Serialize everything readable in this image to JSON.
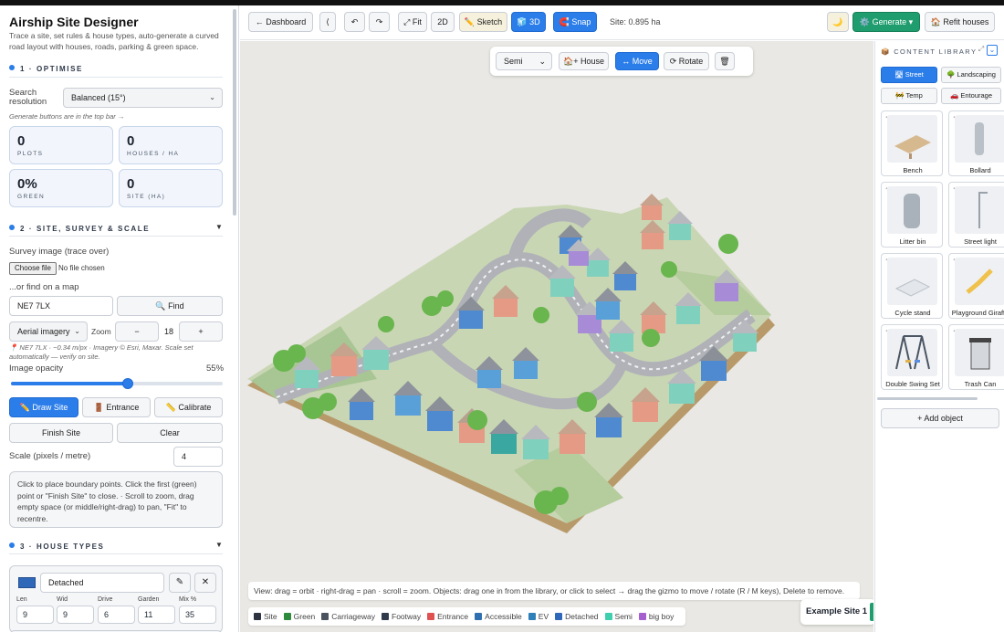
{
  "app": {
    "title": "Airship Site Designer",
    "subtitle": "Trace a site, set rules & house types, auto-generate a curved road layout with houses, roads, parking & green space."
  },
  "optimise": {
    "heading": "1 · OPTIMISE",
    "search_label": "Search resolution",
    "search_value": "Balanced (15°)",
    "note": "Generate buttons are in the top bar →",
    "stats": [
      {
        "value": "0",
        "label": "PLOTS"
      },
      {
        "value": "0",
        "label": "HOUSES / HA"
      },
      {
        "value": "0%",
        "label": "GREEN"
      },
      {
        "value": "0",
        "label": "SITE (HA)"
      }
    ]
  },
  "survey": {
    "heading": "2 · SITE, SURVEY & SCALE",
    "caret": "▼",
    "survey_label": "Survey image (trace over)",
    "choose_file": "Choose file",
    "no_file": "No file chosen",
    "find_label": "...or find on a map",
    "postcode": "NE7 7LX",
    "find_button": "🔍 Find",
    "imagery": "Aerial imagery",
    "zoom_label": "Zoom",
    "zoom_minus": "−",
    "zoom_value": "18",
    "zoom_plus": "+",
    "imagery_note": "📍 NE7 7LX · ~0.34 m/px · Imagery © Esri, Maxar. Scale set automatically — verify on site.",
    "opacity_label": "Image opacity",
    "opacity_value": "55%",
    "opacity_fraction": 0.55,
    "draw_site": "✏️ Draw Site",
    "entrance": "🚪 Entrance",
    "calibrate": "📏 Calibrate",
    "finish_site": "Finish Site",
    "clear": "Clear",
    "scale_label": "Scale (pixels / metre)",
    "scale_value": "4",
    "hint": "Click to place boundary points. Click the first (green) point or \"Finish Site\" to close. · Scroll to zoom, drag empty space (or middle/right-drag) to pan, \"Fit\" to recentre."
  },
  "house_types": {
    "heading": "3 · HOUSE TYPES",
    "caret": "▼",
    "card": {
      "name": "Detached",
      "swatch_color": "#2f68b8",
      "edit_icon": "✎",
      "remove_icon": "✕",
      "fields": [
        {
          "label": "Len",
          "value": "9"
        },
        {
          "label": "Wid",
          "value": "9"
        },
        {
          "label": "Drive",
          "value": "6"
        },
        {
          "label": "Garden",
          "value": "11"
        },
        {
          "label": "Mix %",
          "value": "35"
        }
      ]
    }
  },
  "topbar": {
    "dashboard": "← Dashboard",
    "collapse": "⟨",
    "undo": "↶",
    "redo": "↷",
    "fit": "⤢ Fit",
    "twod": "2D",
    "sketch": "✏️ Sketch",
    "threed": "🧊 3D",
    "snap": "🧲 Snap",
    "site_area": "Site: 0.895 ha",
    "theme": "🌙",
    "generate": "⚙️ Generate ▾",
    "refit": "🏠 Refit houses"
  },
  "viewport_toolbar": {
    "type_select": "Semi",
    "house": "🏠+ House",
    "move": "↔ Move",
    "rotate": "⟳ Rotate",
    "delete": "🗑"
  },
  "help_text": "View: drag = orbit · right-drag = pan · scroll = zoom. Objects: drag one in from the library, or click to select → drag the gizmo to move / rotate (R / M keys), Delete to remove.",
  "legend": [
    {
      "label": "Site",
      "color": "#2d3340"
    },
    {
      "label": "Green",
      "color": "#2e8b3e"
    },
    {
      "label": "Carriageway",
      "color": "#4a5260"
    },
    {
      "label": "Footway",
      "color": "#2f3b4c"
    },
    {
      "label": "Entrance",
      "color": "#e05252"
    },
    {
      "label": "Accessible",
      "color": "#2f6fb0"
    },
    {
      "label": "EV",
      "color": "#2f7fb8"
    },
    {
      "label": "Detached",
      "color": "#2f68b8"
    },
    {
      "label": "Semi",
      "color": "#3ecfae"
    },
    {
      "label": "big boy",
      "color": "#a55fcf"
    }
  ],
  "example_label": "Example Site 1",
  "library": {
    "heading": "📦 CONTENT LIBRARY",
    "categories": [
      "🛣 Street",
      "🌳 Landscaping",
      "🚧 Temp",
      "🚗 Entourage"
    ],
    "items": [
      "Bench",
      "Bollard",
      "Litter bin",
      "Street light",
      "Cycle stand",
      "Playground Giraffe",
      "Double Swing Set",
      "Trash Can"
    ],
    "add_object": "+ Add object"
  }
}
